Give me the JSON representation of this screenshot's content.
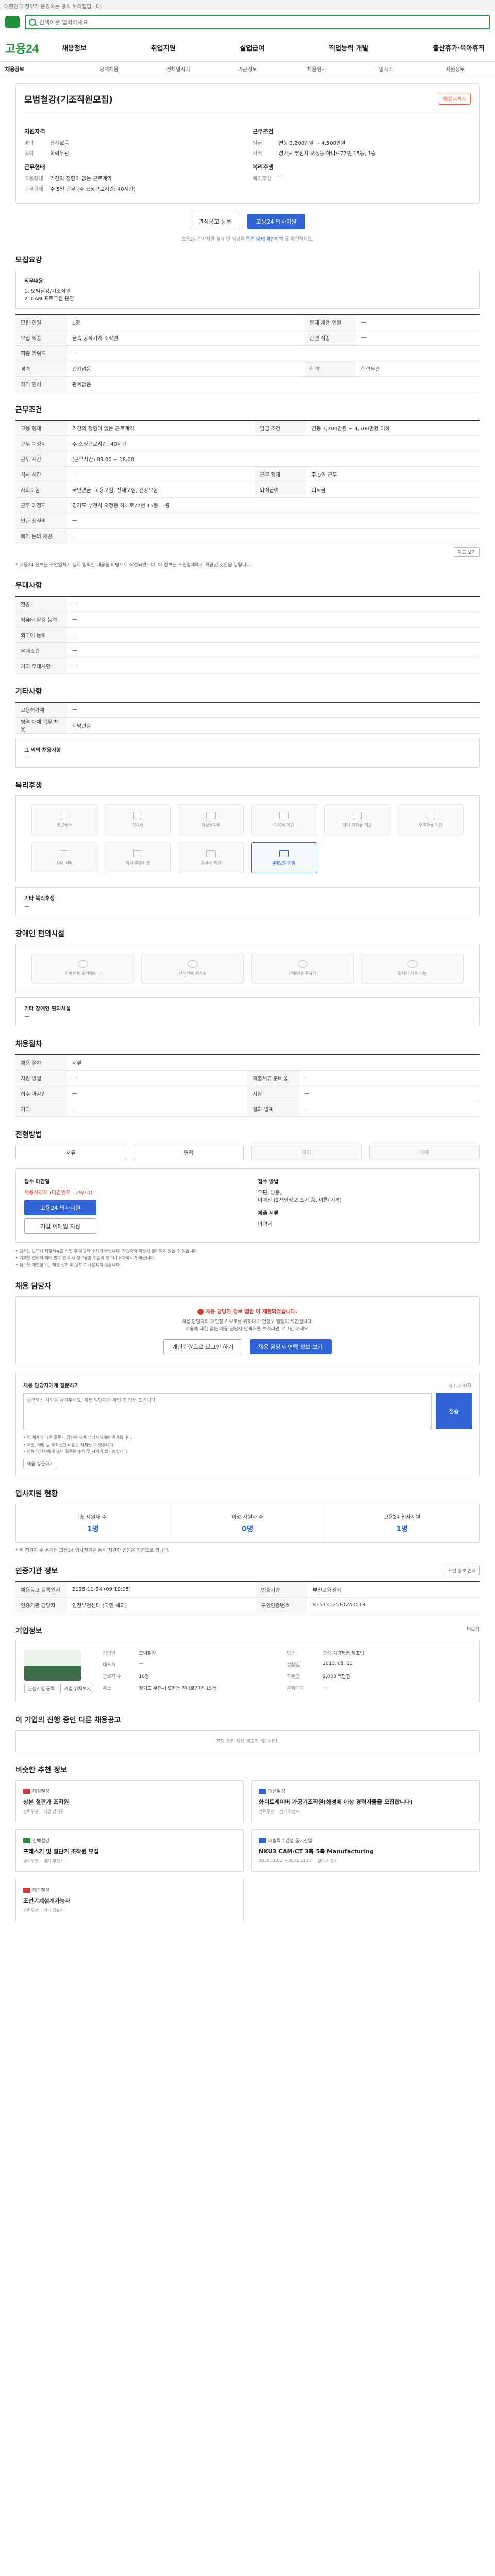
{
  "topbar": {
    "notice": "대한민국 정부가 운영하는 공식 누리집입니다."
  },
  "header": {
    "brand": "고용24",
    "search_placeholder": "검색어를 입력하세요",
    "menu": [
      "채용정보",
      "취업지원",
      "실업급여",
      "직업능력 개발",
      "출산휴가·육아휴직"
    ]
  },
  "lnb": [
    "채용정보",
    "공개채용",
    "전체일자리",
    "기관정보",
    "채용행사",
    "일자리",
    "지원정보"
  ],
  "job": {
    "company": "모범철강(기조직원모집)",
    "badge": "채용시까지",
    "left_title": "지원자격",
    "left_kv": [
      {
        "k": "경력",
        "v": "관계없음"
      },
      {
        "k": "학력",
        "v": "학력무관"
      }
    ],
    "left_title2": "근무형태",
    "left_kv2": [
      {
        "k": "고용형태",
        "v": "기간의 정함이 없는 근로계약"
      },
      {
        "k": "근무형태",
        "v": "주 5일 근무 (주 소정근로시간: 40시간)"
      }
    ],
    "right_title": "근무조건",
    "right_kv": [
      {
        "k": "임금",
        "v": "연봉 3,200만원 ~ 4,500만원"
      },
      {
        "k": "지역",
        "v": "경기도 부천시 오정동 하나로77번 15동, 1층"
      }
    ],
    "right_title2": "복리후생",
    "right_kv2": [
      {
        "k": "복리후생",
        "v": "—"
      }
    ],
    "btn_scrap": "관심공고 등록",
    "btn_apply": "고용24 입사지원",
    "note_pre": "고용24 입사지원 절차 및 방법은 ",
    "note_link": "입력 예제 확인하기",
    "note_post": " 를 확인하세요."
  },
  "detail": {
    "title": "모집요강",
    "duty_label": "직무내용",
    "duty_text": "1. 모범철강/기조직원\n2. CAM 프로그램 운영",
    "rows": [
      {
        "k": "모집 인원",
        "v": "1명",
        "k2": "현재 채용 인원",
        "v2": "—"
      },
      {
        "k": "모집 직종",
        "v": "금속 공작기계 조작원",
        "k2": "관련 직종",
        "v2": "—"
      },
      {
        "k": "직종 키워드",
        "v": "—",
        "k2": "",
        "v2": ""
      },
      {
        "k": "경력",
        "v": "관계없음",
        "k2": "학력",
        "v2": "학력무관"
      },
      {
        "k": "자격 면허",
        "v": "관계없음",
        "k2": "",
        "v2": ""
      }
    ]
  },
  "cond": {
    "title": "근무조건",
    "rows": [
      {
        "k": "고용 형태",
        "v": "기간의 정함이 없는 근로계약",
        "k2": "임금 조건",
        "v2": "연봉 3,200만원 ~ 4,500만원 이하"
      },
      {
        "k": "근무 예정지",
        "v": "주 소정근로시간: 40시간",
        "k2": "",
        "v2": ""
      },
      {
        "k": "근무 시간",
        "v": "(근무시간) 09:00 ~ 18:00",
        "k2": "",
        "v2": ""
      },
      {
        "k": "식사 시간",
        "v": "—",
        "k2": "근무 형태",
        "v2": "주 5일 근무"
      },
      {
        "k": "사회보험",
        "v": "국민연금, 고용보험, 산재보험, 건강보험",
        "k2": "퇴직급여",
        "v2": "퇴직금"
      },
      {
        "k": "근무 예정지",
        "v": "경기도 부천시 오정동 하나로77번 15동, 1층",
        "k2": "",
        "v2": ""
      },
      {
        "k": "인근 전철역",
        "v": "—",
        "k2": "",
        "v2": ""
      },
      {
        "k": "복리 논의 제공",
        "v": "—",
        "k2": "",
        "v2": ""
      }
    ],
    "map_btn": "지도 보기",
    "footnote": "* 고용24 정보는 구인업체가 실제 입력한 내용을 바탕으로 작성되었으며, 이 정보는 구인업체에서 제공된 것임을 알립니다."
  },
  "pref": {
    "title": "우대사항",
    "rows": [
      {
        "k": "전공",
        "v": "—"
      },
      {
        "k": "컴퓨터 활용 능력",
        "v": "—"
      },
      {
        "k": "외국어 능력",
        "v": "—"
      },
      {
        "k": "우대조건",
        "v": "—"
      },
      {
        "k": "기타 우대사항",
        "v": "—"
      }
    ]
  },
  "etc": {
    "title": "기타사항",
    "rows": [
      {
        "k": "고용허가제",
        "v": "—"
      },
      {
        "k": "병역 대체 복무 채용",
        "v": "희망안함"
      }
    ],
    "extra_label": "그 외의 채용사항",
    "extra_value": "—"
  },
  "benefit": {
    "title": "복리후생",
    "items": [
      {
        "label": "통근버스",
        "icon": "bus-icon",
        "active": false
      },
      {
        "label": "기숙사",
        "icon": "dorm-icon",
        "active": false
      },
      {
        "label": "차량유지비",
        "icon": "car-icon",
        "active": false
      },
      {
        "label": "교육비 지원",
        "icon": "education-icon",
        "active": false
      },
      {
        "label": "자녀 학자금 지원",
        "icon": "scholarship-icon",
        "active": false
      },
      {
        "label": "주택자금 지원",
        "icon": "house-icon",
        "active": false
      },
      {
        "label": "사내 식당",
        "icon": "meal-icon",
        "active": false
      },
      {
        "label": "직원 휴양시설",
        "icon": "resort-icon",
        "active": false
      },
      {
        "label": "중식비 지원",
        "icon": "lunch-icon",
        "active": false
      },
      {
        "label": "4대보험 가입",
        "icon": "insurance-icon",
        "active": true
      }
    ],
    "extra_label": "기타 복리후생",
    "extra_value": "—"
  },
  "barrier": {
    "title": "장애인 편의시설",
    "items": [
      "장애인용 엘리베이터",
      "장애인용 화장실",
      "장애인용 주차장",
      "휠체어 사용 가능"
    ],
    "extra_label": "기타 장애인 편의시설",
    "extra_value": "—"
  },
  "recruit": {
    "title": "채용절차",
    "rows": [
      {
        "k": "채용 절차",
        "v": "서류",
        "k2": "",
        "v2": ""
      },
      {
        "k": "지원 방법",
        "v": "—",
        "k2": "제출서류 준비물",
        "v2": "—"
      },
      {
        "k": "접수 마감일",
        "v": "—",
        "k2": "시험",
        "v2": "—"
      },
      {
        "k": "기타",
        "v": "—",
        "k2": "결과 발표",
        "v2": "—"
      }
    ]
  },
  "steps": {
    "title": "전형방법",
    "items": [
      {
        "label": "서류",
        "dim": false
      },
      {
        "label": "면접",
        "dim": false
      },
      {
        "label": "필기",
        "dim": true
      },
      {
        "label": "기타",
        "dim": true
      }
    ]
  },
  "apply": {
    "col1_title": "접수 마감일",
    "deadline": "채용시까지 (마감인지 : 29/10)",
    "btn_apply": "고용24 입사지원",
    "btn_other": "기업 이메일 지원",
    "col2_title": "접수 방법",
    "methods": "우편, 방문,\n이메일 (1개인정보 포기 중, 이름(기본)",
    "col3_title": "제출 서류",
    "docs": "이력서",
    "bullets": [
      "• 원서는 반드시 제출서류를 확인 후 지원해 주시기 바랍니다. 지원자격 미달시 불이익이 있을 수 있습니다.",
      "• 기재된 연락처 외에 별도 연락 시 정보유출 위험이 있으니 유의하시기 바랍니다.",
      "• 접수된 개인정보는 채용 절차 외 용도로 사용되지 않습니다."
    ]
  },
  "manager": {
    "title": "채용 담당자",
    "warn": "채용 담당자 정보 열람 이 제한되었습니다.",
    "desc": "채용 담당자의 개인정보 보호를 위하여 개인정보 열람이 제한됩니다.\n이용에 제한 없는 채용 담당자 연락처를 보시려면 로그인 하세요.",
    "btn_login": "개인회원으로 로그인 하기",
    "btn_view": "채용 담당자 연락 정보 보기"
  },
  "inquiry": {
    "title": "채용 담당자에게 질문하기",
    "counter": "0 / 500자",
    "placeholder": "궁금하신 사항을 남겨주세요. 채용 담당자가 확인 후 답변 드립니다.",
    "submit": "전송",
    "bullets": [
      "• 이 채용에 대한 질문과 답변은 채용 담당자에게만 공개됩니다.",
      "• 욕설, 비방 등 부적절한 내용은 삭제될 수 있습니다.",
      "• 채용 담당자에게 보낸 질문은 수정 및 삭제가 불가능합니다."
    ],
    "btn_history": "채용 질문하기"
  },
  "stats": {
    "title": "입사지원 현황",
    "items": [
      {
        "lbl": "총 지원자 수",
        "num": "1명"
      },
      {
        "lbl": "여성 지원자 수",
        "num": "0명"
      },
      {
        "lbl": "고용24 입사지원",
        "num": "1명"
      }
    ],
    "footnote": "* 위 지원자 수 통계는 고용24 입사지원을 통해 지원한 인원을 기준으로 합니다."
  },
  "registration": {
    "title": "인증기관 정보",
    "print_btn": "구인 정보 인쇄",
    "rows": [
      {
        "k": "채용공고 등록일시",
        "v": "2025-10-24 (09:19:05)",
        "k2": "인증기관",
        "v2": "부천고용센터"
      },
      {
        "k": "인증기관 담당자",
        "v": "인천부천센터 (국민 해외)",
        "k2": "구인인증번호",
        "v2": "K151312510240013"
      }
    ]
  },
  "company": {
    "title": "기업정보",
    "more": "더보기",
    "facts": [
      {
        "k": "기업명",
        "v": "모범철강"
      },
      {
        "k": "업종",
        "v": "금속 가공제품 제조업"
      },
      {
        "k": "대표자",
        "v": "—"
      },
      {
        "k": "설립일",
        "v": "2013. 08. 11"
      },
      {
        "k": "근로자 수",
        "v": "10명"
      },
      {
        "k": "자본금",
        "v": "2,000 백만원"
      },
      {
        "k": "주소",
        "v": "경기도 부천시 오정동 하나로77번 15동"
      },
      {
        "k": "홈페이지",
        "v": "—"
      }
    ],
    "btn_interest": "관심기업 등록",
    "btn_map": "기업 위치보기"
  },
  "other": {
    "title": "이 기업의 진행 중인 다른 채용공고",
    "empty": "진행 중인 채용 공고가 없습니다."
  },
  "reco": {
    "title": "비슷한 추천 정보",
    "items": [
      {
        "company": "대성철강",
        "logo": "r",
        "title": "상본 철판가 조작원",
        "meta1": "경력무관",
        "meta2": "서울 강서구"
      },
      {
        "company": "대신철강",
        "logo": "b",
        "title": "화이트레이버 가공기조작원(화성에 이상 경력자들을 모집합니다)",
        "meta1": "경력무관",
        "meta2": "경기 화성시"
      },
      {
        "company": "한백철강",
        "logo": "g",
        "title": "프레스기 및 절단기 조작원 모집",
        "meta1": "경력무관",
        "meta2": "경기 부천시"
      },
      {
        "company": "대림특수건설 동서산업",
        "logo": "b",
        "title": "NKU3 CAM/CT 3축 5축 Manufacturing",
        "meta1": "2025.11.02 ~ 2025.11.07",
        "meta2": "경기 시흥시"
      },
      {
        "company": "대광철강",
        "logo": "r",
        "title": "조선기계설계가능자",
        "meta1": "경력무관",
        "meta2": "경기 김포시"
      }
    ]
  }
}
